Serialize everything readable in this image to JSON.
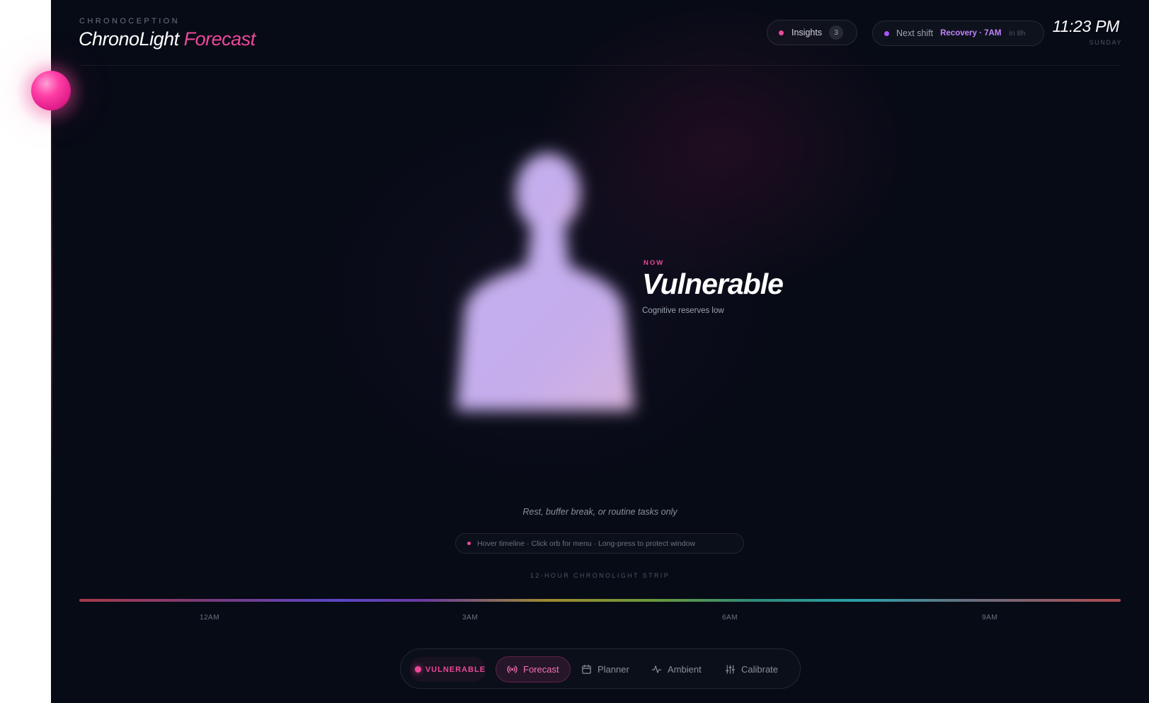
{
  "app": {
    "eyebrow": "CHRONOCEPTION",
    "title_main": "ChronoLight",
    "title_accent": "Forecast",
    "accent_color": "#ec4899"
  },
  "header": {
    "insights": {
      "label": "Insights",
      "count": "3",
      "dot_color": "#ec4899"
    },
    "next_shift": {
      "label": "Next shift",
      "value": "Recovery · 7AM",
      "eta": "in 8h",
      "dot_color": "#a855f7"
    },
    "clock": {
      "time": "11:23 PM",
      "day": "SUNDAY"
    }
  },
  "state": {
    "now_label": "NOW",
    "title": "Vulnerable",
    "subtitle": "Cognitive reserves low",
    "recommendation": "Rest, buffer break, or routine tasks only"
  },
  "hint": {
    "text": "Hover timeline · Click orb for menu · Long-press to protect window",
    "dot_color": "#ec4899"
  },
  "timeline": {
    "label": "12-HOUR CHRONOLIGHT STRIP",
    "ticks": [
      "12AM",
      "3AM",
      "6AM",
      "9AM"
    ]
  },
  "nav": {
    "status_label": "VULNERABLE",
    "items": [
      {
        "label": "Forecast",
        "icon": "broadcast-icon",
        "active": true
      },
      {
        "label": "Planner",
        "icon": "calendar-icon",
        "active": false
      },
      {
        "label": "Ambient",
        "icon": "activity-icon",
        "active": false
      },
      {
        "label": "Calibrate",
        "icon": "sliders-icon",
        "active": false
      }
    ]
  }
}
